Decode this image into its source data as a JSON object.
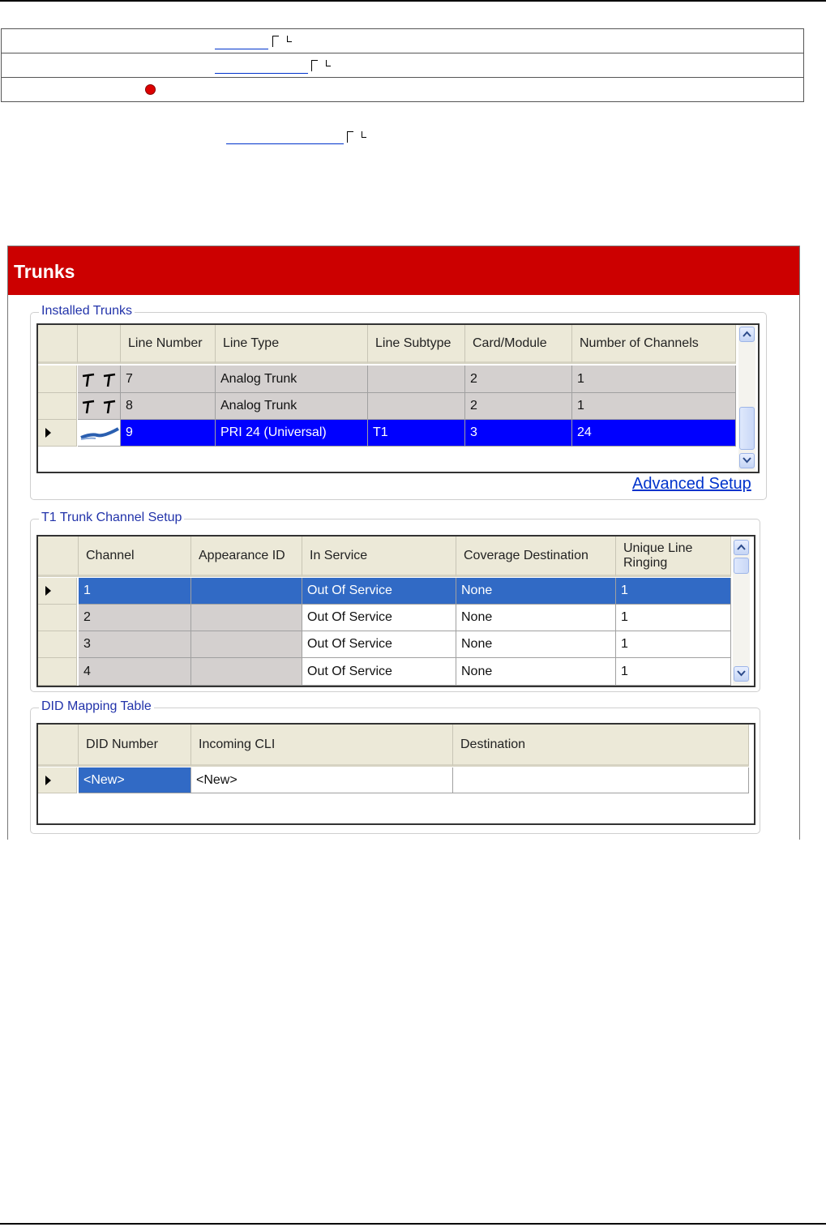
{
  "page": {
    "ref_links": [
      "",
      "",
      "",
      ""
    ]
  },
  "panel": {
    "title": "Trunks",
    "installed_trunks": {
      "title": "Installed Trunks",
      "columns": [
        "Line Number",
        "Line Type",
        "Line Subtype",
        "Card/Module",
        "Number of Channels"
      ],
      "rows": [
        {
          "icon": "analog-trunk-icon",
          "line_number": "7",
          "line_type": "Analog Trunk",
          "line_subtype": "",
          "card_module": "2",
          "channels": "1"
        },
        {
          "icon": "analog-trunk-icon",
          "line_number": "8",
          "line_type": "Analog Trunk",
          "line_subtype": "",
          "card_module": "2",
          "channels": "1"
        },
        {
          "icon": "pri-cable-icon",
          "line_number": "9",
          "line_type": "PRI 24 (Universal)",
          "line_subtype": "T1",
          "card_module": "3",
          "channels": "24",
          "selected": true
        }
      ],
      "advanced_link": "Advanced Setup"
    },
    "channel_setup": {
      "title": "T1 Trunk Channel Setup",
      "columns": [
        "Channel",
        "Appearance ID",
        "In Service",
        "Coverage Destination",
        "Unique Line Ringing"
      ],
      "rows": [
        {
          "channel": "1",
          "appearance_id": "",
          "in_service": "Out Of Service",
          "coverage": "None",
          "unique_ringing": "1",
          "selected": true
        },
        {
          "channel": "2",
          "appearance_id": "",
          "in_service": "Out Of Service",
          "coverage": "None",
          "unique_ringing": "1"
        },
        {
          "channel": "3",
          "appearance_id": "",
          "in_service": "Out Of Service",
          "coverage": "None",
          "unique_ringing": "1"
        },
        {
          "channel": "4",
          "appearance_id": "",
          "in_service": "Out Of Service",
          "coverage": "None",
          "unique_ringing": "1"
        }
      ]
    },
    "did_mapping": {
      "title": "DID Mapping Table",
      "columns": [
        "DID Number",
        "Incoming CLI",
        "Destination"
      ],
      "rows": [
        {
          "did_number": "<New>",
          "incoming_cli": "<New>",
          "destination": ""
        }
      ]
    }
  },
  "colors": {
    "header_red": "#cc0000",
    "selected_blue": "#0000ff",
    "selected_xp_blue": "#316ac5",
    "group_title_blue": "#2233aa",
    "link_blue": "#0033cc"
  }
}
